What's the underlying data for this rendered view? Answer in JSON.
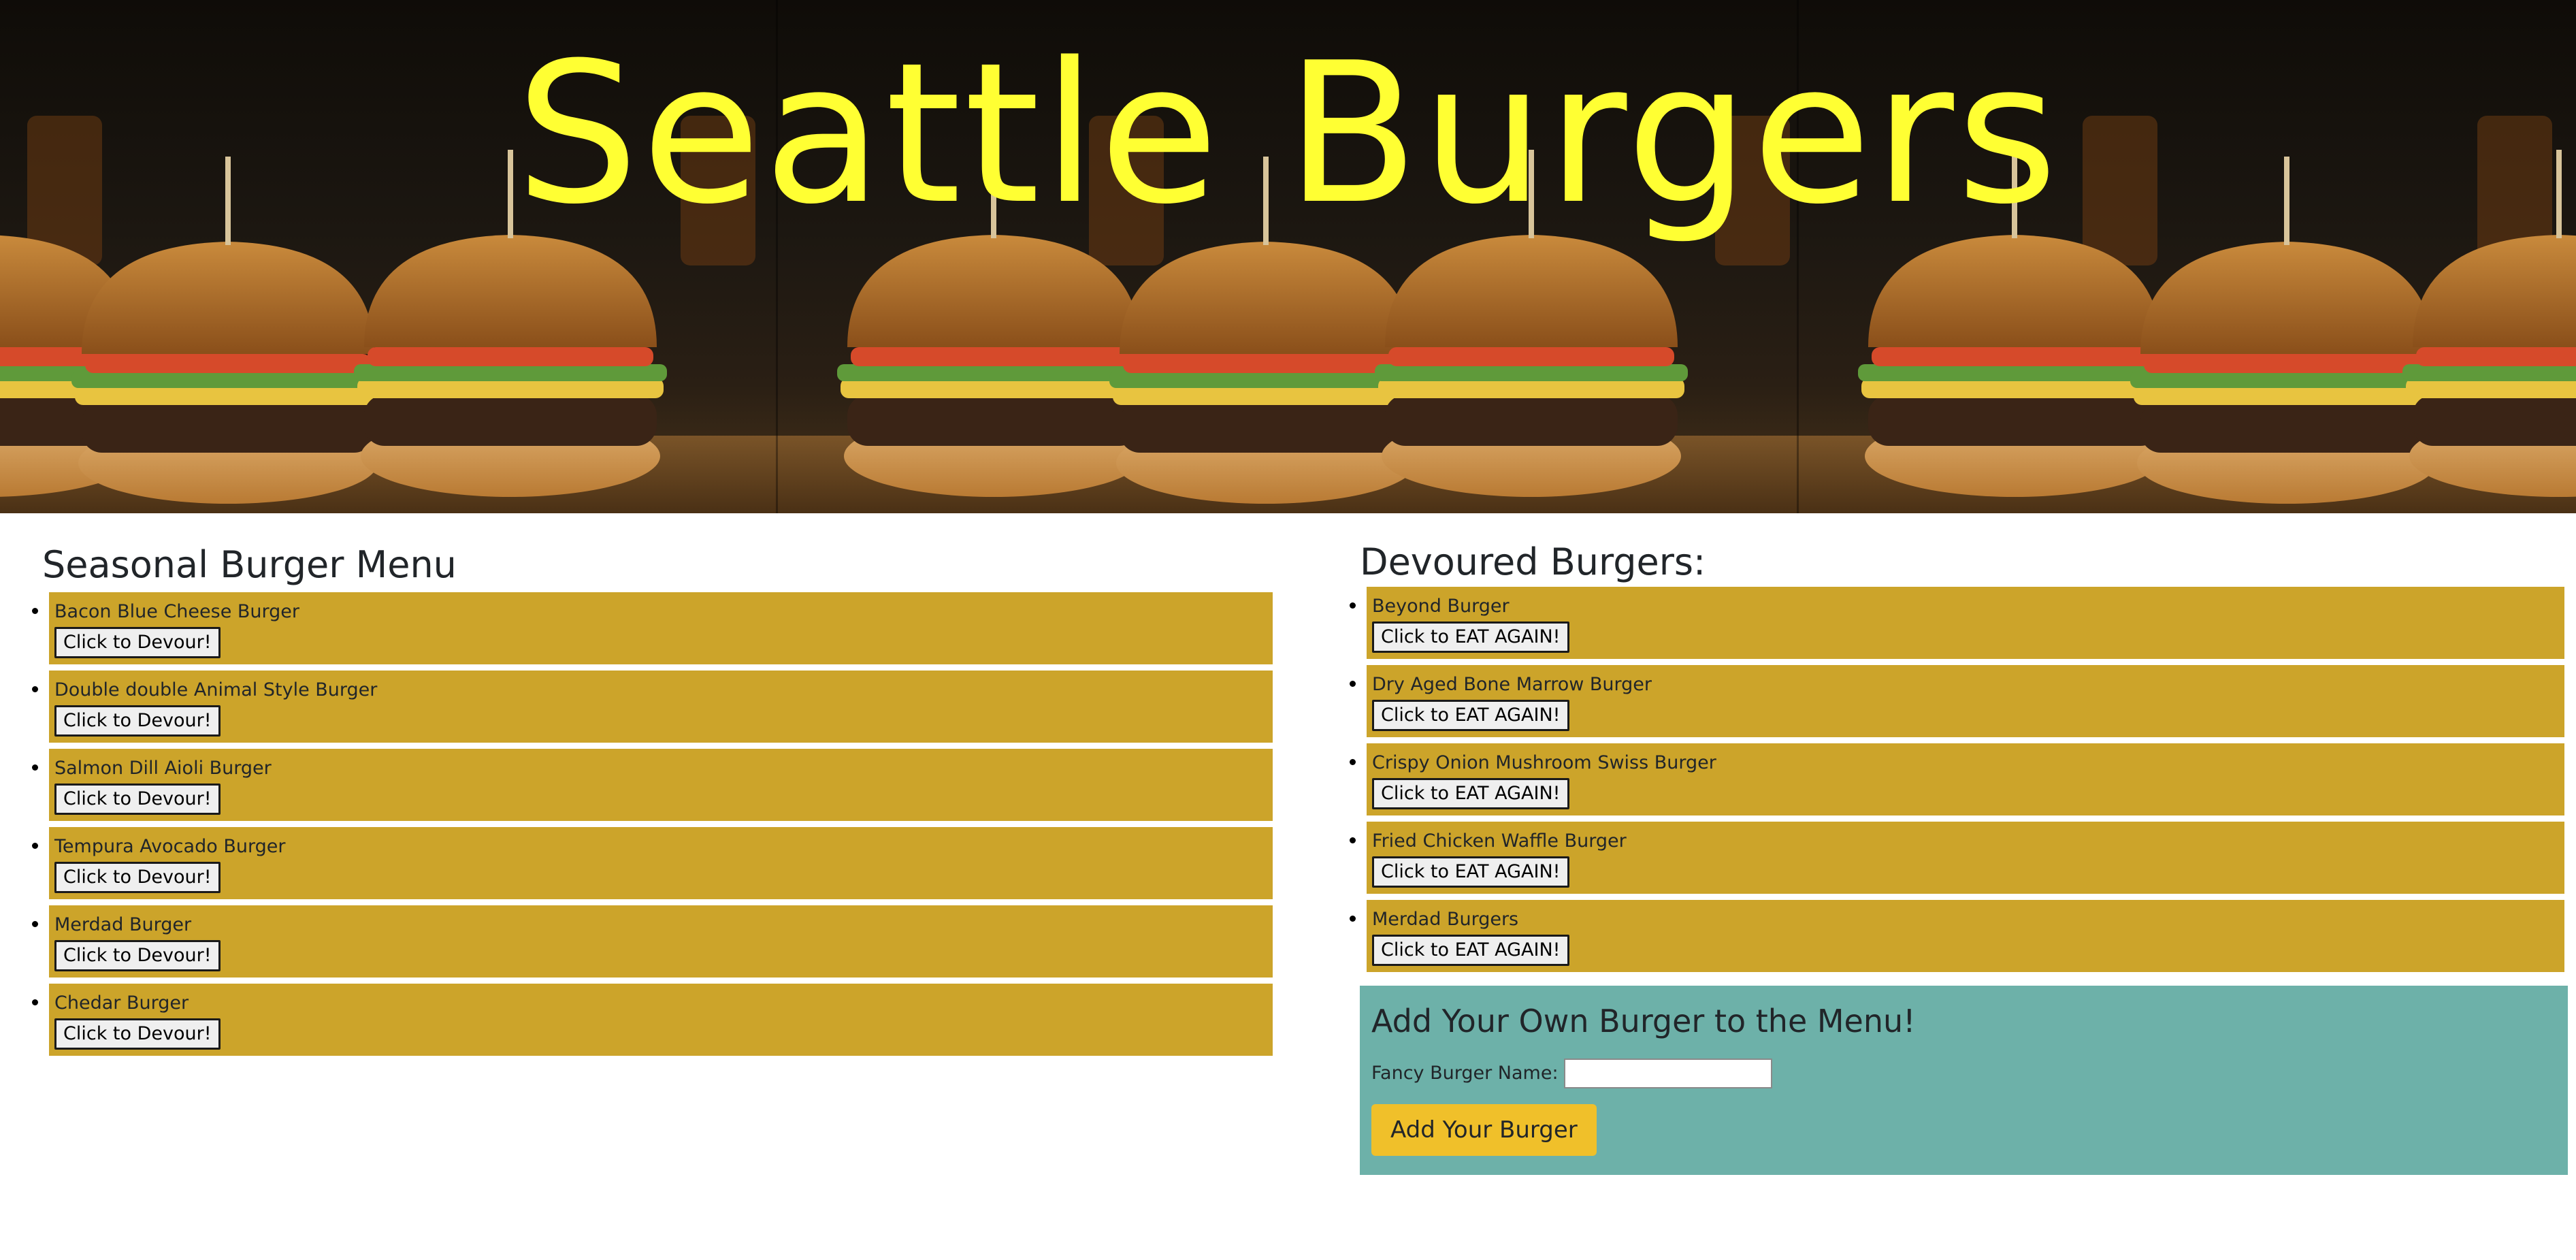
{
  "header": {
    "title": "Seattle Burgers"
  },
  "menu": {
    "title": "Seasonal Burger Menu",
    "button_label": "Click to Devour!",
    "items": [
      {
        "name": "Bacon Blue Cheese Burger"
      },
      {
        "name": "Double double Animal Style Burger"
      },
      {
        "name": "Salmon Dill Aioli Burger"
      },
      {
        "name": "Tempura Avocado Burger"
      },
      {
        "name": "Merdad Burger"
      },
      {
        "name": "Chedar Burger"
      }
    ]
  },
  "devoured": {
    "title": "Devoured Burgers:",
    "button_label": "Click to EAT AGAIN!",
    "items": [
      {
        "name": "Beyond Burger"
      },
      {
        "name": "Dry Aged Bone Marrow Burger"
      },
      {
        "name": "Crispy Onion Mushroom Swiss Burger"
      },
      {
        "name": "Fried Chicken Waffle Burger"
      },
      {
        "name": "Merdad Burgers"
      }
    ]
  },
  "add_form": {
    "title": "Add Your Own Burger to the Menu!",
    "field_label": "Fancy Burger Name:",
    "field_value": "",
    "submit_label": "Add Your Burger"
  },
  "colors": {
    "title_yellow": "#ffff33",
    "item_gold": "#cca42a",
    "form_teal": "#6db1a9",
    "submit_yellow": "#f0c02a"
  }
}
